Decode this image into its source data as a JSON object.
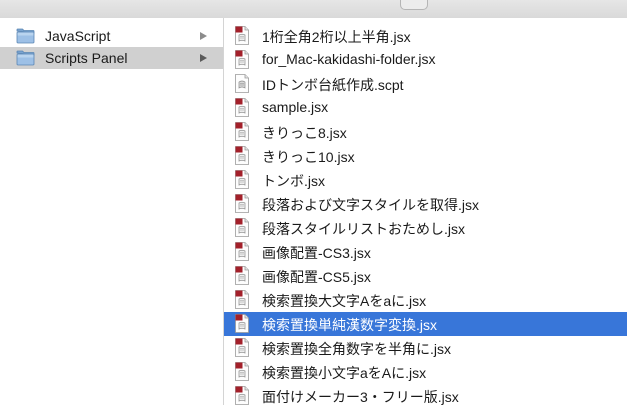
{
  "folders": [
    {
      "label": "JavaScript",
      "icon": "folder-icon",
      "state": "normal"
    },
    {
      "label": "Scripts Panel",
      "icon": "folder-icon",
      "state": "selected-inactive"
    }
  ],
  "files": [
    {
      "label": "1桁全角2桁以上半角.jsx",
      "icon": "jsx-script-icon"
    },
    {
      "label": "for_Mac-kakidashi-folder.jsx",
      "icon": "jsx-script-icon"
    },
    {
      "label": "IDトンボ台紙作成.scpt",
      "icon": "applescript-icon"
    },
    {
      "label": "sample.jsx",
      "icon": "jsx-script-icon"
    },
    {
      "label": "きりっこ8.jsx",
      "icon": "jsx-script-icon"
    },
    {
      "label": "きりっこ10.jsx",
      "icon": "jsx-script-icon"
    },
    {
      "label": "トンボ.jsx",
      "icon": "jsx-script-icon"
    },
    {
      "label": "段落および文字スタイルを取得.jsx",
      "icon": "jsx-script-icon"
    },
    {
      "label": "段落スタイルリストおためし.jsx",
      "icon": "jsx-script-icon"
    },
    {
      "label": "画像配置-CS3.jsx",
      "icon": "jsx-script-icon"
    },
    {
      "label": "画像配置-CS5.jsx",
      "icon": "jsx-script-icon"
    },
    {
      "label": "検索置換大文字Aをaに.jsx",
      "icon": "jsx-script-icon"
    },
    {
      "label": "検索置換単純漢数字変換.jsx",
      "icon": "jsx-script-icon",
      "selected": true
    },
    {
      "label": "検索置換全角数字を半角に.jsx",
      "icon": "jsx-script-icon"
    },
    {
      "label": "検索置換小文字aをAに.jsx",
      "icon": "jsx-script-icon"
    },
    {
      "label": "面付けメーカー3・フリー版.jsx",
      "icon": "jsx-script-icon"
    }
  ],
  "colors": {
    "selection_active": "#3876d9",
    "selection_inactive": "#d0d0d0",
    "folder_blue": "#8fb4da",
    "script_red": "#a3202a"
  }
}
